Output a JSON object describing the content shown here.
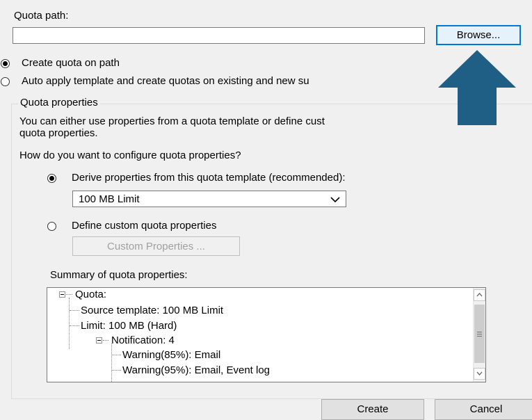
{
  "quota_path": {
    "label": "Quota path:",
    "value": "",
    "browse_label": "Browse..."
  },
  "scope": {
    "create_on_path": "Create quota on path",
    "auto_apply": "Auto apply template and create quotas on existing and new su"
  },
  "properties": {
    "group_title": "Quota properties",
    "description_line1": "You can either use properties from a quota template or define cust",
    "description_line2": "quota properties.",
    "question": "How do you want to configure quota properties?",
    "derive_label": "Derive properties from this quota template (recommended):",
    "template_selected": "100 MB Limit",
    "custom_label": "Define custom quota properties",
    "custom_button": "Custom Properties ..."
  },
  "summary": {
    "label": "Summary of quota properties:",
    "tree": {
      "root": "Quota:",
      "source_template": "Source template: 100 MB Limit",
      "limit": "Limit: 100 MB (Hard)",
      "notification": "Notification: 4",
      "warning85": "Warning(85%): Email",
      "warning95": "Warning(95%): Email, Event log"
    }
  },
  "actions": {
    "create": "Create",
    "cancel": "Cancel"
  },
  "colors": {
    "arrow": "#1f5f86",
    "accent": "#0078d7"
  },
  "icons": {
    "arrow": "up-arrow-annotation",
    "dropdown": "chevron-down-icon"
  }
}
